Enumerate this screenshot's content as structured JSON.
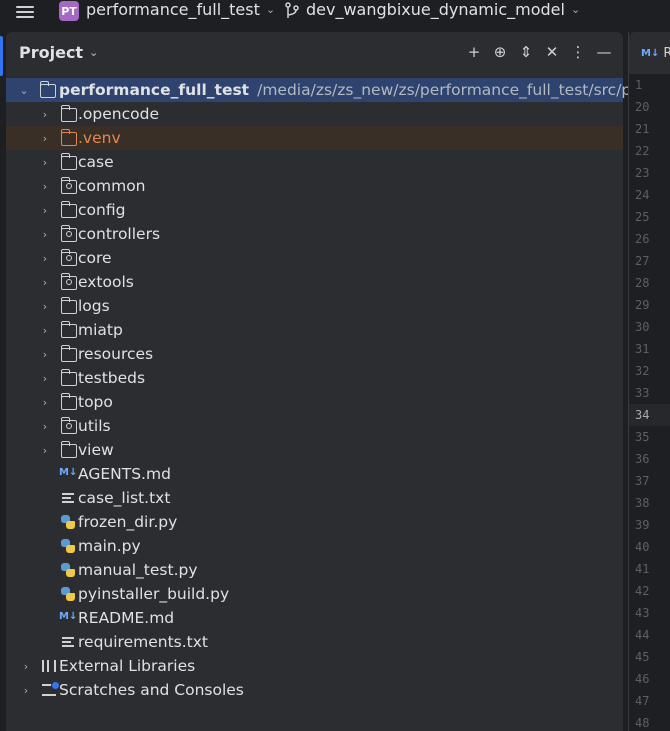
{
  "topbar": {
    "project_badge": "PT",
    "project_name": "performance_full_test",
    "branch_name": "dev_wangbixue_dynamic_model"
  },
  "panel": {
    "title": "Project",
    "tools": [
      "add-icon",
      "locate-icon",
      "expand-collapse-icon",
      "collapse-icon",
      "more-icon",
      "minimize-icon"
    ]
  },
  "tree": {
    "root": {
      "name": "performance_full_test",
      "path": "/media/zs/zs_new/zs/performance_full_test/src/perform"
    },
    "folders": [
      {
        "name": ".opencode",
        "type": "folder"
      },
      {
        "name": ".venv",
        "type": "excluded-folder"
      },
      {
        "name": "case",
        "type": "folder"
      },
      {
        "name": "common",
        "type": "package"
      },
      {
        "name": "config",
        "type": "folder"
      },
      {
        "name": "controllers",
        "type": "package"
      },
      {
        "name": "core",
        "type": "package"
      },
      {
        "name": "extools",
        "type": "package"
      },
      {
        "name": "logs",
        "type": "folder"
      },
      {
        "name": "miatp",
        "type": "folder"
      },
      {
        "name": "resources",
        "type": "folder"
      },
      {
        "name": "testbeds",
        "type": "folder"
      },
      {
        "name": "topo",
        "type": "folder"
      },
      {
        "name": "utils",
        "type": "package"
      },
      {
        "name": "view",
        "type": "folder"
      }
    ],
    "files": [
      {
        "name": "AGENTS.md",
        "type": "markdown"
      },
      {
        "name": "case_list.txt",
        "type": "text"
      },
      {
        "name": "frozen_dir.py",
        "type": "python"
      },
      {
        "name": "main.py",
        "type": "python"
      },
      {
        "name": "manual_test.py",
        "type": "python"
      },
      {
        "name": "pyinstaller_build.py",
        "type": "python"
      },
      {
        "name": "README.md",
        "type": "markdown"
      },
      {
        "name": "requirements.txt",
        "type": "text"
      }
    ],
    "external_libraries": "External Libraries",
    "scratches": "Scratches and Consoles"
  },
  "editor": {
    "tab_badge": "M↓",
    "tab_label": "R",
    "line_numbers": [
      "1",
      "20",
      "21",
      "22",
      "23",
      "24",
      "25",
      "26",
      "27",
      "28",
      "29",
      "30",
      "31",
      "32",
      "33",
      "34",
      "35",
      "36",
      "37",
      "38",
      "39",
      "40",
      "41",
      "42",
      "43",
      "44",
      "45",
      "46",
      "47",
      "48"
    ],
    "current_line": "34"
  },
  "colors": {
    "accent": "#3574f0",
    "selection": "#2e436e",
    "excluded": "#e08855",
    "project_badge": "#a569c4"
  }
}
